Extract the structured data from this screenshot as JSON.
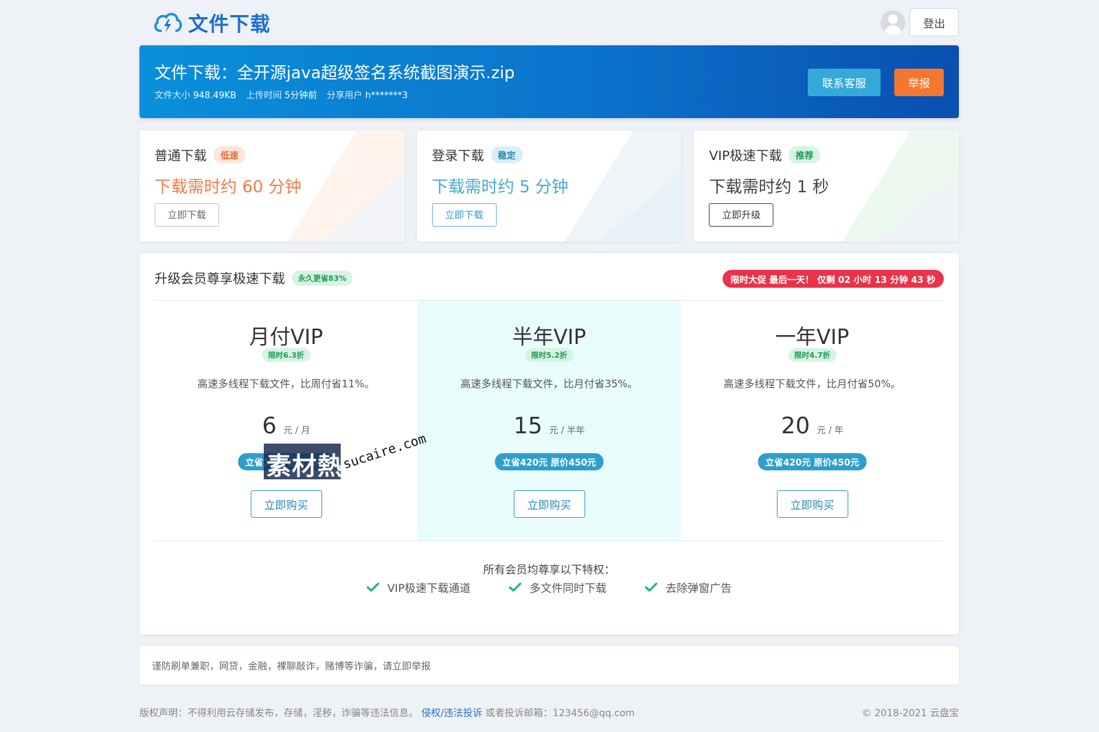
{
  "header": {
    "logo_text": "文件下载",
    "logout_label": "登出"
  },
  "banner": {
    "title": "文件下载：全开源java超级签名系统截图演示.zip",
    "size_label": "文件大小",
    "size_value": "948.49KB",
    "upload_label": "上传时间",
    "upload_value": "5分钟前",
    "user_label": "分享用户",
    "user_value": "h*******3",
    "contact_label": "联系客服",
    "report_label": "举报"
  },
  "download_options": [
    {
      "title": "普通下载",
      "tag": "低速",
      "time": "下载需时约 60 分钟",
      "button": "立即下载"
    },
    {
      "title": "登录下载",
      "tag": "稳定",
      "time": "下载需时约 5 分钟",
      "button": "立即下载"
    },
    {
      "title": "VIP极速下载",
      "tag": "推荐",
      "time": "下载需时约 1 秒",
      "button": "立即升级"
    }
  ],
  "vip": {
    "heading": "升级会员尊享极速下载",
    "heading_tag": "永久更省83%",
    "promo": "限时大促 最后一天！ 仅剩 02 小时 13 分钟 43 秒",
    "plans": [
      {
        "name": "月付VIP",
        "badge": "限时6.3折",
        "desc": "高速多线程下载文件，比周付省11%。",
        "price": "6",
        "unit": "元 / 月",
        "save": "立省17元 原价23元",
        "buy": "立即购买"
      },
      {
        "name": "半年VIP",
        "badge": "限时5.2折",
        "desc": "高速多线程下载文件，比月付省35%。",
        "price": "15",
        "unit": "元 / 半年",
        "save": "立省420元 原价450元",
        "buy": "立即购买"
      },
      {
        "name": "一年VIP",
        "badge": "限时4.7折",
        "desc": "高速多线程下载文件，比月付省50%。",
        "price": "20",
        "unit": "元 / 年",
        "save": "立省420元 原价450元",
        "buy": "立即购买"
      }
    ],
    "perks_title": "所有会员均尊享以下特权：",
    "perks": [
      "VIP极速下载通道",
      "多文件同时下载",
      "去除弹窗广告"
    ]
  },
  "watermark": {
    "cn": "素材熱",
    "en": "sucaire.com"
  },
  "notice": "谨防刷单兼职，网贷，金融，裸聊敲诈，赌博等诈骗，请立即举报",
  "footer": {
    "statement": "版权声明：不得利用云存储发布，存储，淫秽，诈骗等违法信息。",
    "link": "侵权/违法投诉",
    "email_text": "或者投诉邮箱：123456@qq.com",
    "copyright": "© 2018-2021 云盘宝"
  },
  "colors": {
    "primary": "#1c6fd1",
    "banner_start": "#0a90da",
    "banner_end": "#0a4fb0",
    "contact": "#35a9d9",
    "report": "#f5772f",
    "promo": "#e8334a",
    "featured_bg": "#e8fdfb",
    "check": "#1fb56b"
  },
  "icons": [
    "cloud-logo-icon",
    "avatar-icon",
    "check-icon"
  ]
}
